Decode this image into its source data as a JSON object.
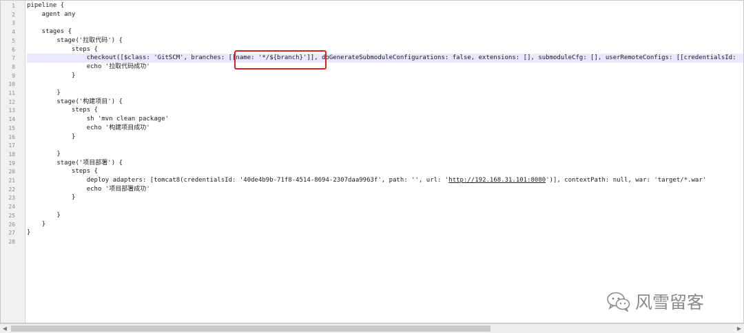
{
  "editor": {
    "line_numbers": [
      "1",
      "2",
      "3",
      "4",
      "5",
      "6",
      "7",
      "8",
      "9",
      "10",
      "11",
      "12",
      "13",
      "14",
      "15",
      "16",
      "17",
      "18",
      "19",
      "20",
      "21",
      "22",
      "23",
      "24",
      "25",
      "26",
      "27",
      "28"
    ],
    "lines": [
      "pipeline {",
      "    agent any",
      "",
      "    stages {",
      "        stage('拉取代码') {",
      "            steps {",
      "                checkout([$class: 'GitSCM', branches: [[name: '*/${branch}']], doGenerateSubmoduleConfigurations: false, extensions: [], submoduleCfg: [], userRemoteConfigs: [[credentialsId: ",
      "                echo '拉取代码成功'",
      "            }",
      "",
      "        }",
      "        stage('构建项目') {",
      "            steps {",
      "                sh 'mvn clean package'",
      "                echo '构建项目成功'",
      "            }",
      "",
      "        }",
      "        stage('项目部署') {",
      "            steps {",
      "                deploy adapters: [tomcat8(credentialsId: '40de4b9b-71f8-4514-8694-2307daa9963f', path: '', url: 'http://192.168.31.101:8080')], contextPath: null, war: 'target/*.war'",
      "                echo '项目部署成功'",
      "            }",
      "",
      "        }",
      "    }",
      "}",
      ""
    ],
    "current_line": 7,
    "highlight_text": "[[name: '*/${branch}']],",
    "link_text": "http://192.168.31.101:8080"
  },
  "scrollbar": {
    "left_arrow": "◀",
    "right_arrow": "▶"
  },
  "watermark": {
    "text": "风雪留客",
    "icon": "wechat-icon"
  },
  "colors": {
    "highlight_border": "#e0201c",
    "current_line_bg": "#e8e8ff"
  }
}
